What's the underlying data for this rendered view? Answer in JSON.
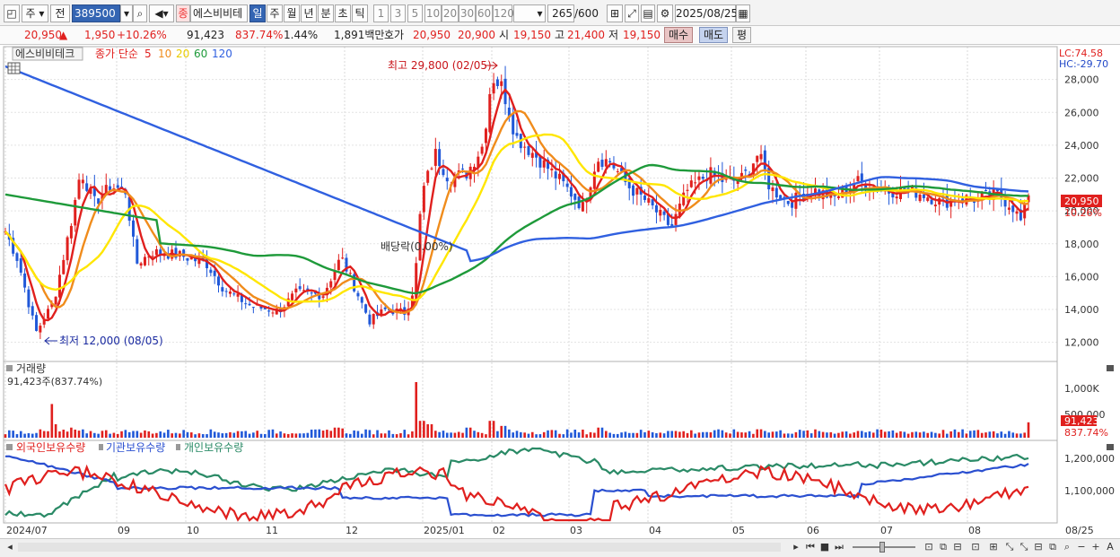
{
  "toolbar": {
    "market": "주",
    "exchange": "전",
    "code": "389500",
    "stock_name": "에스비비테",
    "stock_badge": "종",
    "period_tabs": [
      "일",
      "주",
      "월",
      "년",
      "분",
      "초",
      "틱"
    ],
    "active_period": "일",
    "minute_options": [
      "1",
      "3",
      "5",
      "10",
      "20",
      "30",
      "60",
      "120"
    ],
    "count": "265",
    "count_total": "/600",
    "date": "2025/08/25"
  },
  "info": {
    "price": "20,950",
    "price_arrow": "▲",
    "change": "1,950",
    "change_pct": "+10.26%",
    "volume": "91,423",
    "volume_pct": "837.74%",
    "turnover": "1.44%",
    "amount": "1,891백만",
    "bid_label": "호가",
    "bid1": "20,950",
    "bid2": "20,900",
    "open_label": "시",
    "open": "19,150",
    "high_label": "고",
    "high": "21,400",
    "low_label": "저",
    "low": "19,150",
    "buy": "매수",
    "sell": "매도",
    "avg": "평"
  },
  "price_panel": {
    "name": "에스비비테크",
    "ma_label": "종가 단순",
    "ma_periods": [
      "5",
      "10",
      "20",
      "60",
      "120"
    ],
    "ma_colors": [
      "#e0201e",
      "#f08c1c",
      "#ffe600",
      "#1e9a3a",
      "#3060e0"
    ],
    "lc": "LC:74.58",
    "hc": "HC:-29.70",
    "y_ticks": [
      "28,000",
      "26,000",
      "24,000",
      "22,000",
      "20,000",
      "18,000",
      "16,000",
      "14,000",
      "12,000"
    ],
    "high_note": "최고 29,800 (02/05)",
    "low_note": "최저 12,000 (08/05)",
    "dividend_note": "배당락(0.00%)",
    "last_price_tag": "20,950",
    "last_pct_tag": "10.26%"
  },
  "volume_panel": {
    "title": "거래량",
    "sub": "91,423주(837.74%)",
    "y_ticks": [
      "1,000K",
      "500,000"
    ],
    "last_tag": "91,423",
    "last_pct": "837.74%"
  },
  "holding_panel": {
    "foreign": "외국인보유수량",
    "institution": "기관보유수량",
    "individual": "개인보유수량",
    "y_ticks": [
      "1,200,000",
      "1,100,000"
    ]
  },
  "x_axis": [
    "2024/07",
    "09",
    "10",
    "11",
    "12",
    "2025/01",
    "02",
    "03",
    "04",
    "05",
    "06",
    "07",
    "08",
    "08/25"
  ],
  "chart_data": {
    "type": "candlestick",
    "title": "에스비비테크",
    "x_range": [
      "2024/07",
      "2025/08/25"
    ],
    "y_range": [
      11000,
      30000
    ],
    "last_close": 20950,
    "highest": {
      "value": 29800,
      "date": "02/05"
    },
    "lowest": {
      "value": 12000,
      "date": "08/05"
    },
    "monthly_close_approx": [
      {
        "x": "2024/07",
        "close": 17000
      },
      {
        "x": "2024/08",
        "close": 21500
      },
      {
        "x": "2024/09",
        "close": 17000
      },
      {
        "x": "2024/10",
        "close": 17200
      },
      {
        "x": "2024/11",
        "close": 14200
      },
      {
        "x": "2024/12",
        "close": 14000
      },
      {
        "x": "2025/01",
        "close": 21500
      },
      {
        "x": "2025/02",
        "close": 24000
      },
      {
        "x": "2025/03",
        "close": 20500
      },
      {
        "x": "2025/04",
        "close": 20000
      },
      {
        "x": "2025/05",
        "close": 22000
      },
      {
        "x": "2025/06",
        "close": 21000
      },
      {
        "x": "2025/07",
        "close": 21000
      },
      {
        "x": "2025/08",
        "close": 20950
      }
    ]
  }
}
